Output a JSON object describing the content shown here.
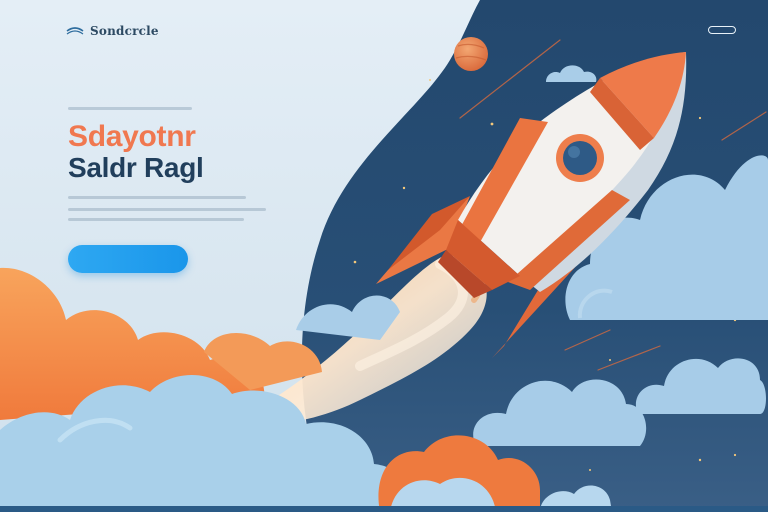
{
  "brand": {
    "name": "Sondcrcle"
  },
  "nav": {
    "links": [
      "",
      "",
      ""
    ],
    "right_link": "",
    "button_label": ""
  },
  "hero": {
    "eyebrow": "",
    "headline_line1": "Sdayotnr",
    "headline_line2": "Saldr Ragl",
    "cta_label": ""
  },
  "colors": {
    "accent_orange": "#f07850",
    "navy": "#213f5c",
    "cta_blue": "#1f9cee",
    "sky_dark": "#1e4568"
  },
  "icons": [
    "logo-icon",
    "rocket-illustration",
    "planet-icon"
  ]
}
